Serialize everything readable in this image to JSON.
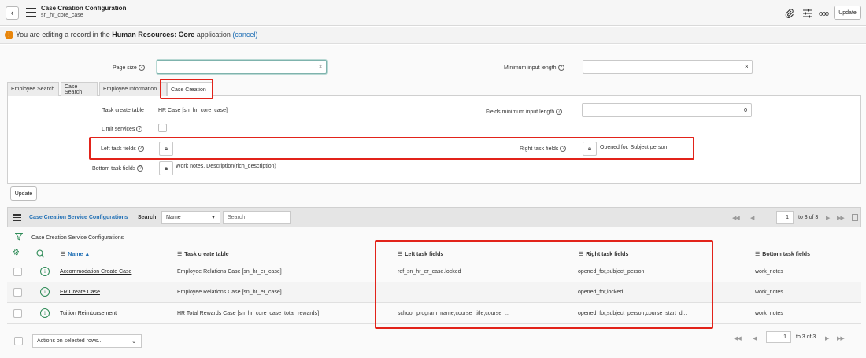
{
  "header": {
    "title": "Case Creation Configuration",
    "subtitle": "sn_hr_core_case",
    "update_label": "Update",
    "icons": [
      "back-icon",
      "menu-icon",
      "paperclip-icon",
      "sliders-icon",
      "more-icon"
    ]
  },
  "banner": {
    "prefix": "You are editing a record in the ",
    "scope": "Human Resources: Core",
    "suffix": " application ",
    "cancel": "(cancel)"
  },
  "form": {
    "page_size_label": "Page size",
    "page_size_value": "",
    "min_input_label": "Minimum input length",
    "min_input_value": "3"
  },
  "tabs": [
    "Employee Search",
    "Case Search",
    "Employee Information",
    "Case Creation"
  ],
  "case_creation": {
    "task_create_table_label": "Task create table",
    "task_create_table_value": "HR Case [sn_hr_core_case]",
    "fields_min_label": "Fields minimum input length",
    "fields_min_value": "0",
    "limit_services_label": "Limit services",
    "left_fields_label": "Left task fields",
    "left_fields_value": "",
    "right_fields_label": "Right task fields",
    "right_fields_value": "Opened for, Subject person",
    "bottom_fields_label": "Bottom task fields",
    "bottom_fields_value": "Work notes, Description(rich_description)"
  },
  "update_button": "Update",
  "list": {
    "title": "Case Creation Service Configurations",
    "search_label": "Search",
    "search_field": "Name",
    "search_placeholder": "Search",
    "page_value": "1",
    "page_of": "to 3 of 3",
    "breadcrumb": "Case Creation Service Configurations",
    "columns": [
      "Name",
      "Task create table",
      "Left task fields",
      "Right task fields",
      "Bottom task fields"
    ],
    "sort_indicator": "▲",
    "rows": [
      {
        "name": "Accommodation Create Case",
        "table": "Employee Relations Case [sn_hr_er_case]",
        "left": "ref_sn_hr_er_case.locked",
        "right": "opened_for,subject_person",
        "bottom": "work_notes"
      },
      {
        "name": "ER Create Case",
        "table": "Employee Relations Case [sn_hr_er_case]",
        "left": "",
        "right": "opened_for,locked",
        "bottom": "work_notes"
      },
      {
        "name": "Tuition Reimbursement",
        "table": "HR Total Rewards Case [sn_hr_core_case_total_rewards]",
        "left": "school_program_name,course_title,course_...",
        "right": "opened_for,subject_person,course_start_d...",
        "bottom": "work_notes"
      }
    ],
    "actions_label": "Actions on selected rows...",
    "footer_page_value": "1",
    "footer_page_of": "to 3 of 3"
  }
}
